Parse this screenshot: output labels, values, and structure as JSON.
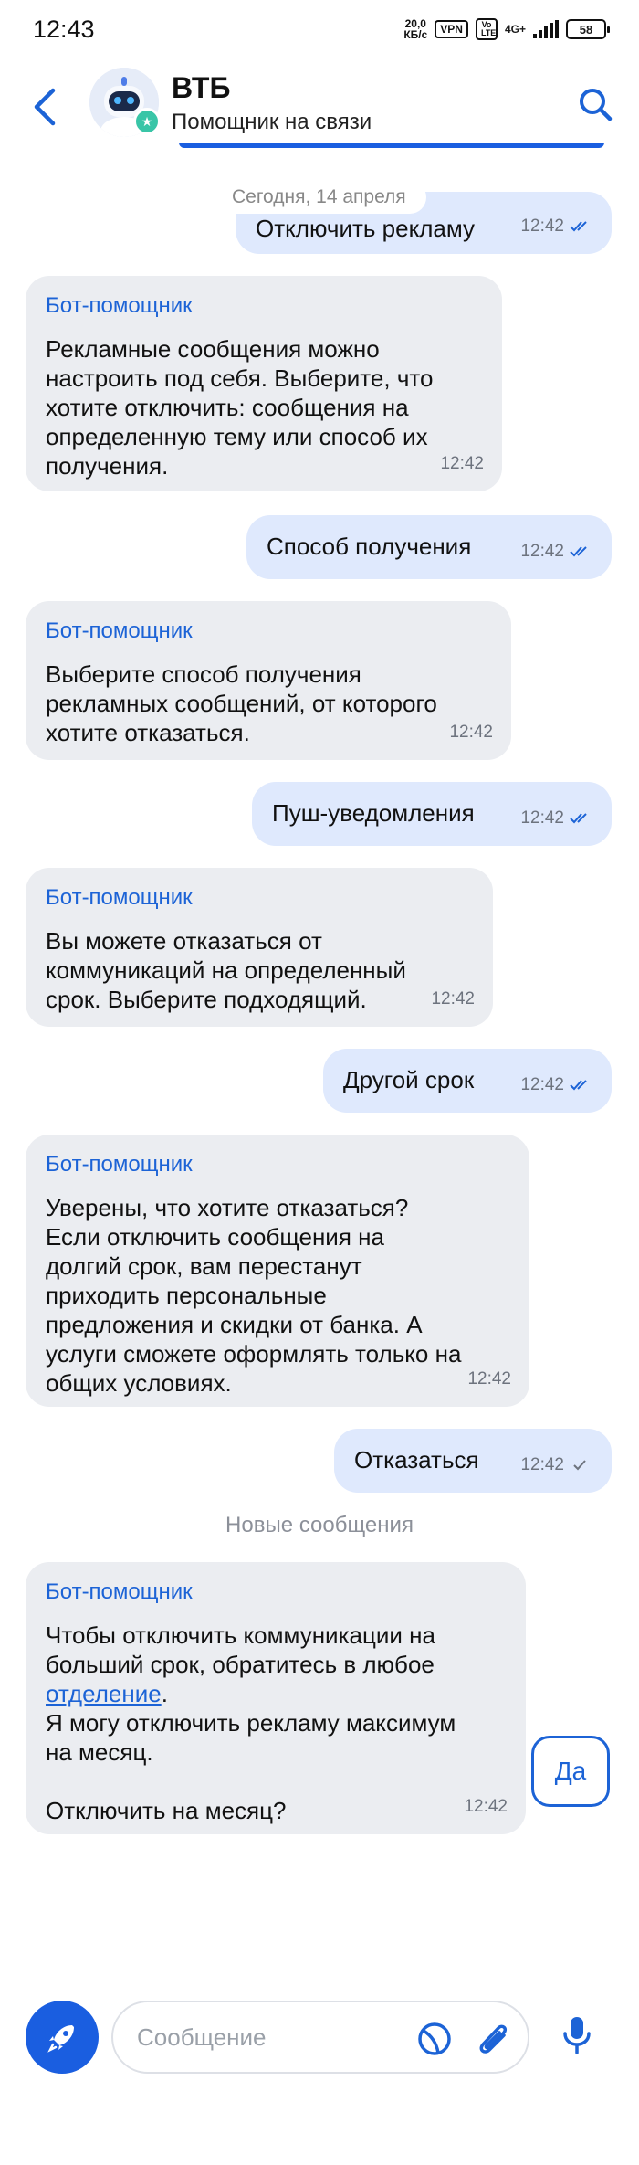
{
  "status_bar": {
    "time": "12:43",
    "speed_value": "20,0",
    "speed_unit": "КБ/с",
    "vpn": "VPN",
    "volte": "Vo LTE",
    "network": "4G+",
    "battery": "58"
  },
  "header": {
    "title": "ВТБ",
    "subtitle": "Помощник на связи"
  },
  "chat": {
    "date_label": "Сегодня, 14 апреля",
    "new_messages_label": "Новые сообщения",
    "messages": [
      {
        "direction": "out",
        "text": "Отключить рекламу",
        "time": "12:42",
        "status": "read"
      },
      {
        "direction": "in",
        "sender": "Бот-помощник",
        "text": "Рекламные сообщения можно\nнастроить под себя. Выберите, что\nхотите отключить: сообщения на\nопределенную тему или способ их\nполучения.",
        "time": "12:42"
      },
      {
        "direction": "out",
        "text": "Способ получения",
        "time": "12:42",
        "status": "read"
      },
      {
        "direction": "in",
        "sender": "Бот-помощник",
        "text": "Выберите способ получения\nрекламных сообщений, от которого\nхотите отказаться.",
        "time": "12:42"
      },
      {
        "direction": "out",
        "text": "Пуш-уведомления",
        "time": "12:42",
        "status": "read"
      },
      {
        "direction": "in",
        "sender": "Бот-помощник",
        "text": "Вы можете отказаться от\nкоммуникаций на определенный\nсрок. Выберите подходящий.",
        "time": "12:42"
      },
      {
        "direction": "out",
        "text": "Другой срок",
        "time": "12:42",
        "status": "read"
      },
      {
        "direction": "in",
        "sender": "Бот-помощник",
        "text": "Уверены, что хотите отказаться?\nЕсли отключить сообщения на\nдолгий срок, вам перестанут\nприходить персональные\nпредложения и скидки от банка. А\nуслуги сможете оформлять только на\nобщих условиях.",
        "time": "12:42"
      },
      {
        "direction": "out",
        "text": "Отказаться",
        "time": "12:42",
        "status": "sent"
      },
      {
        "direction": "in",
        "sender": "Бот-помощник",
        "text_before_link": "Чтобы отключить коммуникации на\nбольший срок, обратитесь в любое\n",
        "link_text": "отделение",
        "text_after_link": ".\nЯ могу отключить рекламу максимум\nна месяц.\n\nОтключить на месяц?",
        "time": "12:42"
      }
    ],
    "quick_reply": "Да"
  },
  "composer": {
    "placeholder": "Сообщение",
    "value": ""
  },
  "colors": {
    "accent": "#1a5ee0",
    "outgoing_bubble": "#dfe9fd",
    "incoming_bubble": "#ebedf1",
    "sender_name": "#1c63d6"
  },
  "icons": [
    "back-arrow-icon",
    "search-icon",
    "tick-icon",
    "rocket-icon",
    "sticker-icon",
    "paperclip-icon",
    "microphone-icon"
  ]
}
